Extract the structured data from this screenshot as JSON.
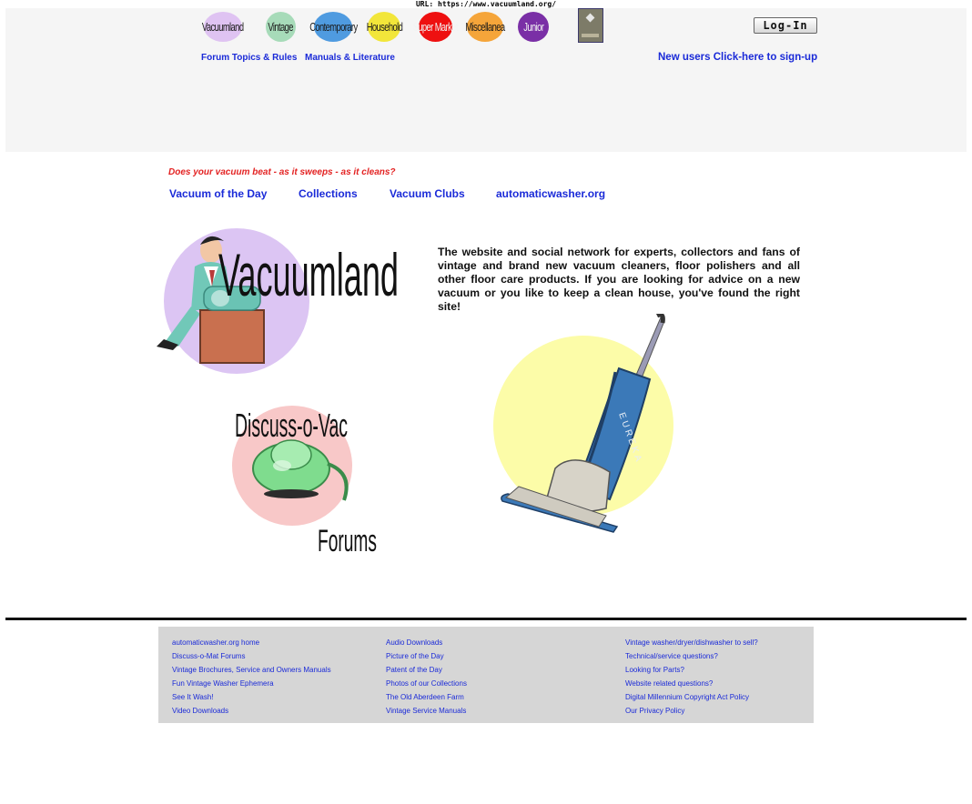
{
  "url_bar": "URL: https://www.vacuumland.org/",
  "categories": [
    {
      "label": "Vacuumland",
      "color": "#dfc3f2"
    },
    {
      "label": "Vintage",
      "color": "#a7dbb9"
    },
    {
      "label": "Contemporary",
      "color": "#4f9be0"
    },
    {
      "label": "Household",
      "color": "#f2e63a"
    },
    {
      "label": "Super Market",
      "color": "#ee1010"
    },
    {
      "label": "Miscellanea",
      "color": "#f5a53a"
    },
    {
      "label": "Junior",
      "color": "#7a2fa6"
    }
  ],
  "login": {
    "label": "Log-In"
  },
  "sub_nav": {
    "forum_topics": "Forum Topics & Rules",
    "manuals": "Manuals & Literature",
    "signup": "New users Click-here to sign-up"
  },
  "tagline": "Does your vacuum beat - as it sweeps - as it cleans?",
  "main_nav": [
    "Vacuum of the Day",
    "Collections",
    "Vacuum Clubs",
    "automaticwasher.org"
  ],
  "logo": {
    "text": "Vacuumland"
  },
  "forum_logo": {
    "title": "Discuss-o-Vac",
    "subtitle": "Forums"
  },
  "vacuum_brand": "EUREKA",
  "intro": "The website and social network for experts, collectors and fans of vintage and brand new vacuum cleaners, floor polishers and all other floor care products. If you are looking for advice on a new vacuum or you like to keep a clean house, you've found the right site!",
  "footer": {
    "col1": [
      "automaticwasher.org home",
      "Discuss-o-Mat Forums",
      "Vintage Brochures, Service and Owners Manuals",
      "Fun Vintage Washer Ephemera",
      "See It Wash!",
      "Video Downloads"
    ],
    "col2": [
      "Audio Downloads",
      "Picture of the Day",
      "Patent of the Day",
      "Photos of our Collections",
      "The Old Aberdeen Farm",
      "Vintage Service Manuals"
    ],
    "col3": [
      "Vintage washer/dryer/dishwasher to sell?",
      "Technical/service questions?",
      "Looking for Parts?",
      "Website related questions?",
      "Digital Millennium Copyright Act Policy",
      "Our Privacy Policy"
    ]
  }
}
